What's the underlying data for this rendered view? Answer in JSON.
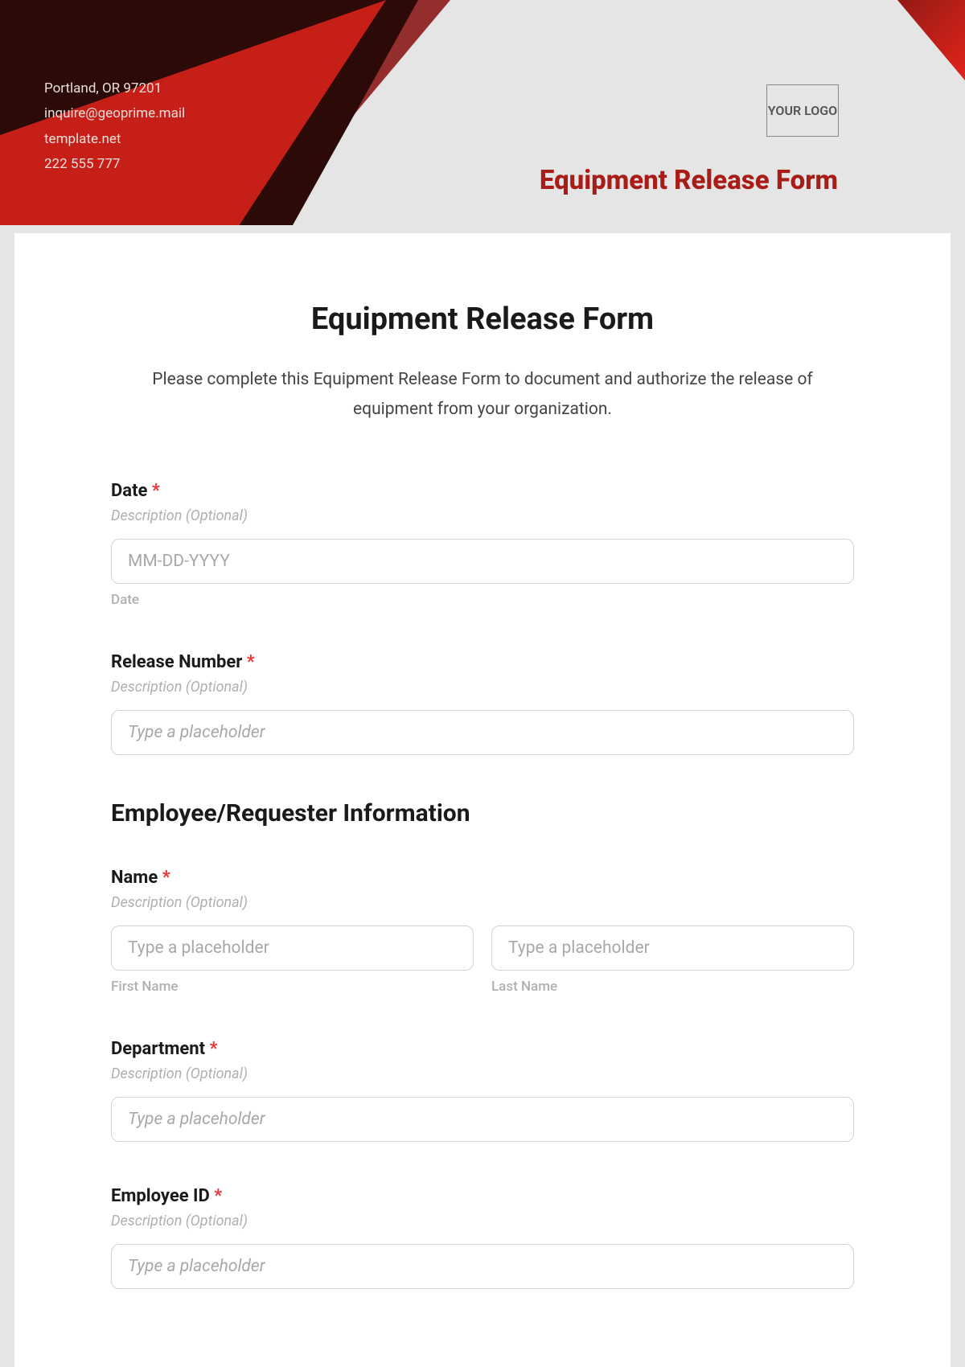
{
  "org": {
    "address": "Portland, OR 97201",
    "email": "inquire@geoprime.mail",
    "website": "template.net",
    "phone": "222 555 777"
  },
  "logo_text": "YOUR LOGO",
  "banner_title": "Equipment Release Form",
  "page_title": "Equipment Release Form",
  "intro": "Please complete this Equipment Release Form to document and authorize the release of equipment from your organization.",
  "required_marker": "*",
  "desc_placeholder": "Description (Optional)",
  "fields": {
    "date": {
      "label": "Date",
      "placeholder": "MM-DD-YYYY",
      "helper": "Date"
    },
    "release_number": {
      "label": "Release Number",
      "placeholder": "Type a placeholder"
    },
    "section_employee": "Employee/Requester Information",
    "name": {
      "label": "Name",
      "first_placeholder": "Type a placeholder",
      "last_placeholder": "Type a placeholder",
      "first_helper": "First Name",
      "last_helper": "Last Name"
    },
    "department": {
      "label": "Department",
      "placeholder": "Type a placeholder"
    },
    "employee_id": {
      "label": "Employee ID",
      "placeholder": "Type a placeholder"
    }
  }
}
